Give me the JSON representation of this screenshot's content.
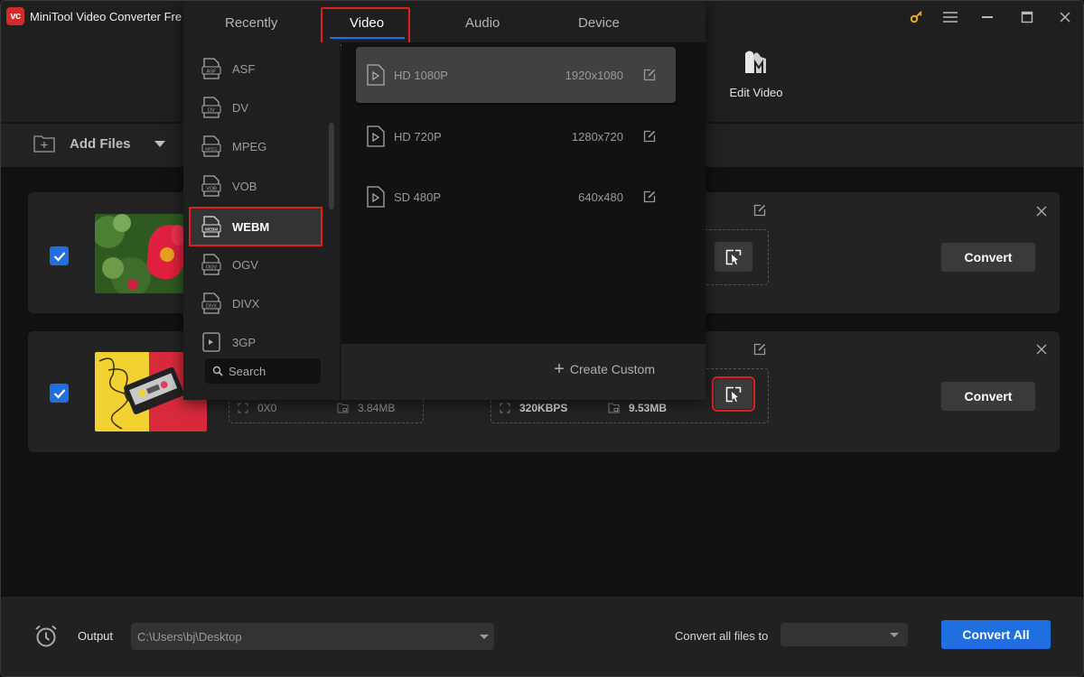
{
  "app": {
    "title": "MiniTool Video Converter Fre",
    "logo_text": "vc"
  },
  "toolbar": {
    "edit_video_label": "Edit Video",
    "add_files_label": "Add Files"
  },
  "popup": {
    "tabs": [
      {
        "label": "Recently",
        "active": false
      },
      {
        "label": "Video",
        "active": true
      },
      {
        "label": "Audio",
        "active": false
      },
      {
        "label": "Device",
        "active": false
      }
    ],
    "formats": [
      {
        "label": "ASF",
        "icon_text": "ASF"
      },
      {
        "label": "DV",
        "icon_text": "DV"
      },
      {
        "label": "MPEG",
        "icon_text": "MPEG"
      },
      {
        "label": "VOB",
        "icon_text": "VOB"
      },
      {
        "label": "WEBM",
        "icon_text": "WEBM",
        "selected": true
      },
      {
        "label": "OGV",
        "icon_text": "OGV"
      },
      {
        "label": "DIVX",
        "icon_text": "DIVX"
      },
      {
        "label": "3GP",
        "icon_text": ""
      }
    ],
    "search_placeholder": "Search",
    "presets": [
      {
        "name": "HD 1080P",
        "resolution": "1920x1080",
        "hover": true
      },
      {
        "name": "HD 720P",
        "resolution": "1280x720"
      },
      {
        "name": "SD 480P",
        "resolution": "640x480"
      }
    ],
    "create_custom_label": "Create Custom"
  },
  "files": [
    {
      "checked": true,
      "thumbnail": "red-flower",
      "convert_label": "Convert"
    },
    {
      "checked": true,
      "thumbnail": "cassette-tape",
      "source": {
        "resolution": "0X0",
        "size": "3.84MB"
      },
      "target": {
        "bitrate": "320KBPS",
        "size": "9.53MB"
      },
      "convert_label": "Convert"
    }
  ],
  "bottom": {
    "output_label": "Output",
    "output_path": "C:\\Users\\bj\\Desktop",
    "convert_all_files_to_label": "Convert all files to",
    "convert_all_files_to_value": "",
    "convert_all_label": "Convert All"
  },
  "colors": {
    "accent_blue": "#1f6fe0",
    "highlight_red": "#e02020",
    "logo_red": "#d42a2a",
    "key_icon_orange": "#f0a820"
  }
}
